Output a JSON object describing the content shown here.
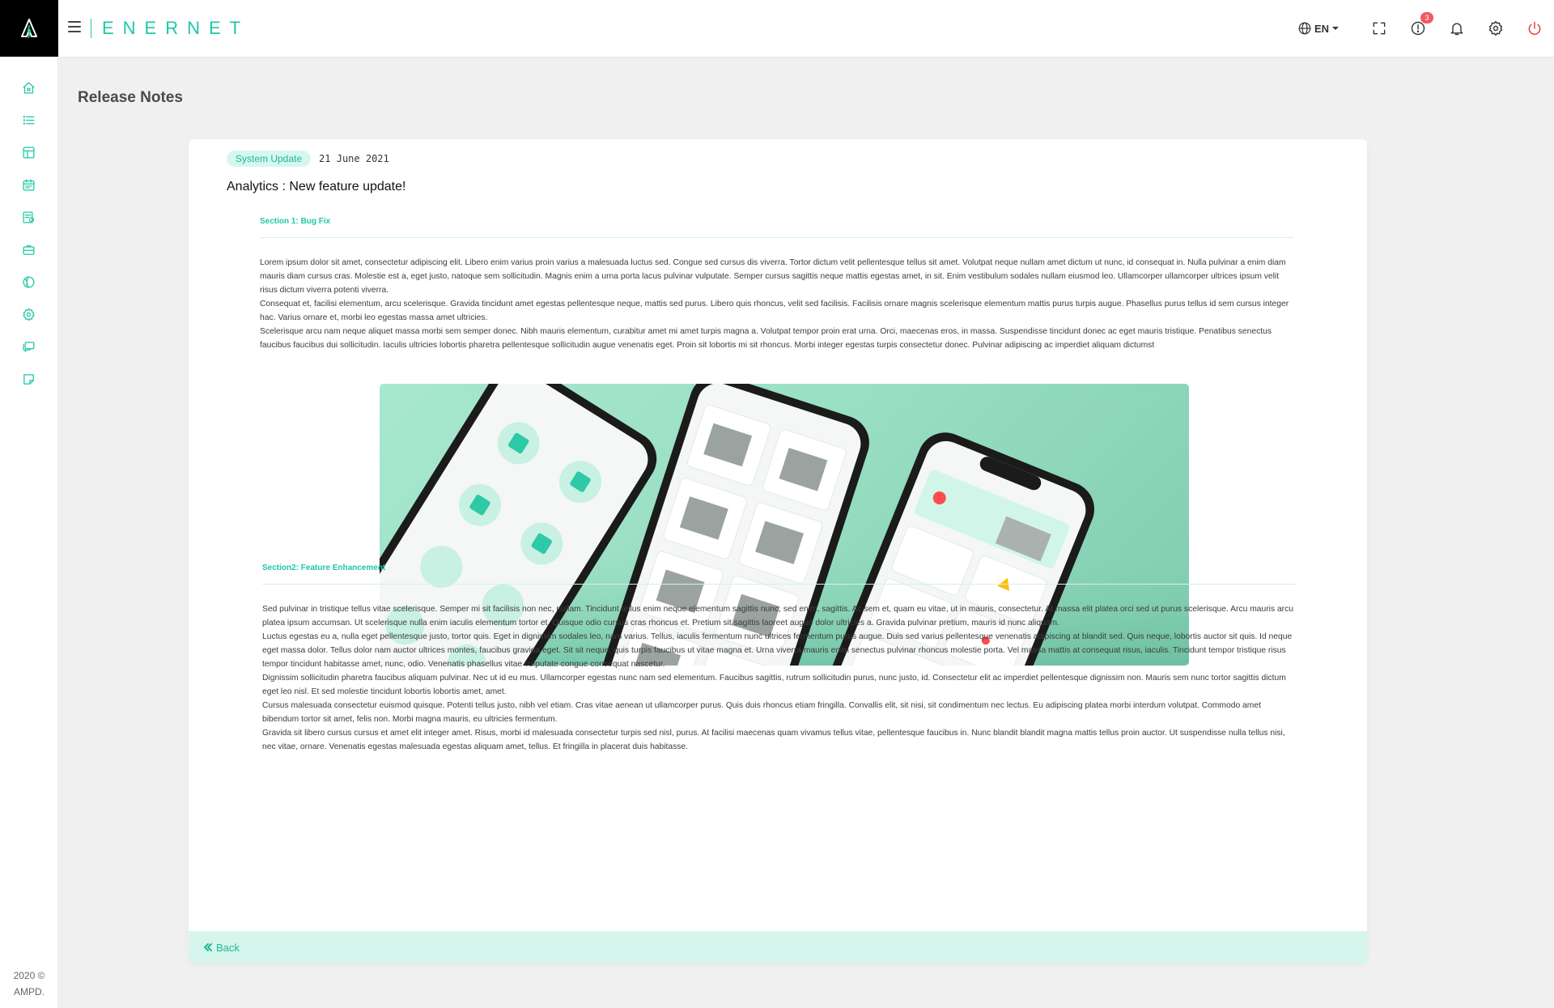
{
  "app": {
    "brand": "ENERNET",
    "copyright": "2020 © AMPD."
  },
  "sidebar": {
    "items": [
      {
        "name": "home-icon"
      },
      {
        "name": "list-icon"
      },
      {
        "name": "layout-icon"
      },
      {
        "name": "calendar-icon"
      },
      {
        "name": "report-icon"
      },
      {
        "name": "briefcase-icon"
      },
      {
        "name": "globe-icon"
      },
      {
        "name": "settings-icon"
      },
      {
        "name": "chat-icon"
      },
      {
        "name": "note-icon"
      }
    ]
  },
  "topbar": {
    "language": "EN",
    "alerts_badge": "3"
  },
  "page": {
    "title": "Release Notes"
  },
  "release": {
    "tag": "System Update",
    "date": "21 June 2021",
    "headline": "Analytics : New feature update!",
    "section1": {
      "label": "Section 1: Bug Fix",
      "paragraphs": [
        "Lorem ipsum dolor sit amet, consectetur adipiscing elit. Libero enim varius proin varius a malesuada luctus sed. Congue sed cursus dis viverra. Tortor dictum velit pellentesque tellus sit amet. Volutpat neque nullam amet dictum ut nunc, id consequat in. Nulla pulvinar a enim diam mauris diam cursus cras. Molestie est a, eget justo, natoque sem sollicitudin. Magnis enim a urna porta lacus pulvinar vulputate. Semper cursus sagittis neque mattis egestas amet, in sit. Enim vestibulum sodales nullam eiusmod leo. Ullamcorper ullamcorper ultrices ipsum velit risus dictum viverra potenti viverra.",
        "Consequat et, facilisi elementum, arcu scelerisque. Gravida tincidunt amet egestas pellentesque neque, mattis sed purus. Libero quis rhoncus, velit sed facilisis. Facilisis ornare magnis scelerisque elementum mattis purus turpis augue. Phasellus purus tellus id sem cursus integer hac. Varius ornare et, morbi leo egestas massa amet ultricies.",
        "Scelerisque arcu nam neque aliquet massa morbi sem semper donec. Nibh mauris elementum, curabitur amet mi amet turpis magna a. Volutpat tempor proin erat urna. Orci, maecenas eros, in massa. Suspendisse tincidunt donec ac eget mauris tristique. Penatibus senectus faucibus faucibus dui sollicitudin. Iaculis ultricies lobortis pharetra pellentesque sollicitudin augue venenatis eget. Proin sit lobortis mi sit rhoncus. Morbi integer egestas turpis consectetur donec. Pulvinar adipiscing ac imperdiet aliquam dictumst"
      ]
    },
    "section2": {
      "label": "Section2: Feature Enhancement",
      "paragraphs": [
        "Sed pulvinar in tristique tellus vitae scelerisque. Semper mi sit facilisis non nec, nullam. Tincidunt tellus enim neque elementum sagittis nunc, sed enim, sagittis. Ac sem et, quam eu vitae, ut in mauris, consectetur. At massa elit platea orci sed ut purus scelerisque. Arcu mauris arcu platea ipsum accumsan. Ut scelerisque nulla enim iaculis elementum tortor et. Quisque odio cursus cras rhoncus et. Pretium sit sagittis laoreet augue dolor ultricies a. Gravida pulvinar pretium, mauris id nunc aliquam.",
        "Luctus egestas eu a, nulla eget pellentesque justo, tortor quis. Eget in dignissim sodales leo, nam varius. Tellus, iaculis fermentum nunc ultrices fermentum purus augue. Duis sed varius pellentesque venenatis adipiscing at blandit sed. Quis neque, lobortis auctor sit quis. Id neque eget massa dolor. Tellus dolor nam auctor ultrices montes, faucibus gravida eget. Sit sit neque, quis turpis faucibus ut vitae magna et. Urna viverra mauris enim senectus pulvinar rhoncus molestie porta. Vel massa mattis at consequat risus, iaculis. Tincidunt tempor tristique risus tempor tincidunt habitasse amet, nunc, odio. Venenatis phasellus vitae vulputate congue consequat nascetur.",
        "Dignissim sollicitudin pharetra faucibus aliquam pulvinar. Nec ut id eu mus. Ullamcorper egestas nunc nam sed elementum. Faucibus sagittis, rutrum sollicitudin purus, nunc justo, id. Consectetur elit ac imperdiet pellentesque dignissim non. Mauris sem nunc tortor sagittis dictum eget leo nisl. Et sed molestie tincidunt lobortis lobortis amet, amet.",
        "Cursus malesuada consectetur euismod quisque. Potenti tellus justo, nibh vel etiam. Cras vitae aenean ut ullamcorper purus. Quis duis rhoncus etiam fringilla. Convallis elit, sit nisi, sit condimentum nec lectus. Eu adipiscing platea morbi interdum volutpat. Commodo amet bibendum tortor sit amet, felis non. Morbi magna mauris, eu ultricies fermentum.",
        "Gravida sit libero cursus cursus et amet elit integer amet. Risus, morbi id malesuada consectetur turpis sed nisl, purus. At facilisi maecenas quam vivamus tellus vitae, pellentesque faucibus in. Nunc blandit blandit magna mattis tellus proin auctor. Ut suspendisse nulla tellus nisi, nec vitae, ornare. Venenatis egestas malesuada egestas aliquam amet, tellus. Et fringilla in placerat duis habitasse."
      ]
    },
    "back_label": "Back"
  },
  "colors": {
    "accent": "#1fc7a6",
    "tag_bg": "#d6f7ef",
    "footer_bg": "#d6f5ec",
    "badge": "#f25961",
    "power": "#e53935"
  }
}
